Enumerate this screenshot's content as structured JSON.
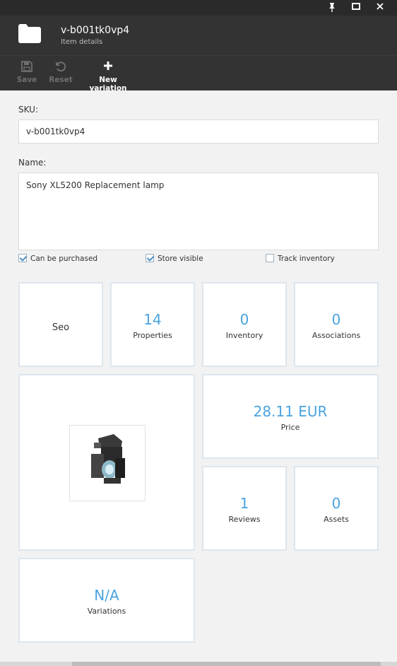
{
  "window": {
    "pin_icon": "pin-icon",
    "maximize_icon": "maximize-icon",
    "close_icon": "close-icon"
  },
  "header": {
    "title": "v-b001tk0vp4",
    "subtitle": "Item details"
  },
  "toolbar": {
    "save_label": "Save",
    "reset_label": "Reset",
    "new_variation_label": "New variation"
  },
  "form": {
    "sku_label": "SKU:",
    "sku_value": "v-b001tk0vp4",
    "name_label": "Name:",
    "name_value": "Sony XL5200 Replacement lamp"
  },
  "checks": [
    {
      "label": "Can be purchased",
      "checked": true
    },
    {
      "label": "Store visible",
      "checked": true
    },
    {
      "label": "Track inventory",
      "checked": false
    }
  ],
  "tiles": {
    "seo": "Seo",
    "properties": {
      "value": "14",
      "label": "Properties"
    },
    "inventory": {
      "value": "0",
      "label": "Inventory"
    },
    "associations": {
      "value": "0",
      "label": "Associations"
    },
    "price": {
      "value": "28.11 EUR",
      "label": "Price"
    },
    "reviews": {
      "value": "1",
      "label": "Reviews"
    },
    "assets": {
      "value": "0",
      "label": "Assets"
    },
    "variations": {
      "value": "N/A",
      "label": "Variations"
    }
  },
  "colors": {
    "accent": "#4aa3df",
    "header_bg": "#333333"
  }
}
